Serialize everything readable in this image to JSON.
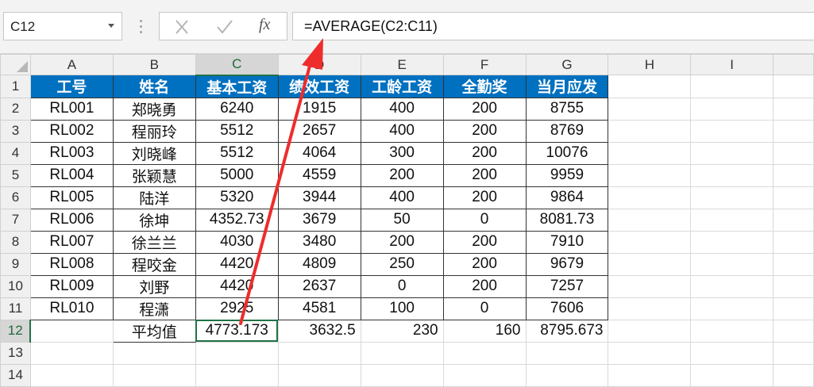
{
  "formula_bar": {
    "name_box": "C12",
    "cancel_icon": "close-icon",
    "enter_icon": "check-icon",
    "fx_label": "fx",
    "formula": "=AVERAGE(C2:C11)"
  },
  "columns": [
    "A",
    "B",
    "C",
    "D",
    "E",
    "F",
    "G",
    "H",
    "I"
  ],
  "row_numbers": [
    "1",
    "2",
    "3",
    "4",
    "5",
    "6",
    "7",
    "8",
    "9",
    "10",
    "11",
    "12",
    "13",
    "14"
  ],
  "table": {
    "headers": [
      "工号",
      "姓名",
      "基本工资",
      "绩效工资",
      "工龄工资",
      "全勤奖",
      "当月应发"
    ],
    "rows": [
      [
        "RL001",
        "郑晓勇",
        "6240",
        "1915",
        "400",
        "200",
        "8755"
      ],
      [
        "RL002",
        "程丽玲",
        "5512",
        "2657",
        "400",
        "200",
        "8769"
      ],
      [
        "RL003",
        "刘晓峰",
        "5512",
        "4064",
        "300",
        "200",
        "10076"
      ],
      [
        "RL004",
        "张颖慧",
        "5000",
        "4559",
        "200",
        "200",
        "9959"
      ],
      [
        "RL005",
        "陆洋",
        "5320",
        "3944",
        "400",
        "200",
        "9864"
      ],
      [
        "RL006",
        "徐坤",
        "4352.73",
        "3679",
        "50",
        "0",
        "8081.73"
      ],
      [
        "RL007",
        "徐兰兰",
        "4030",
        "3480",
        "200",
        "200",
        "7910"
      ],
      [
        "RL008",
        "程咬金",
        "4420",
        "4809",
        "250",
        "200",
        "9679"
      ],
      [
        "RL009",
        "刘野",
        "4420",
        "2637",
        "0",
        "200",
        "7257"
      ],
      [
        "RL010",
        "程潇",
        "2925",
        "4581",
        "100",
        "0",
        "7606"
      ]
    ],
    "average_row": [
      "",
      "平均值",
      "4773.173",
      "3632.5",
      "230",
      "160",
      "8795.673"
    ]
  },
  "selection": {
    "cell": "C12",
    "column": "C",
    "row": "12"
  },
  "colors": {
    "header_fill": "#0070c0",
    "header_text": "#ffffff",
    "selection": "#217346",
    "annotation_arrow": "#ee2c2c"
  }
}
